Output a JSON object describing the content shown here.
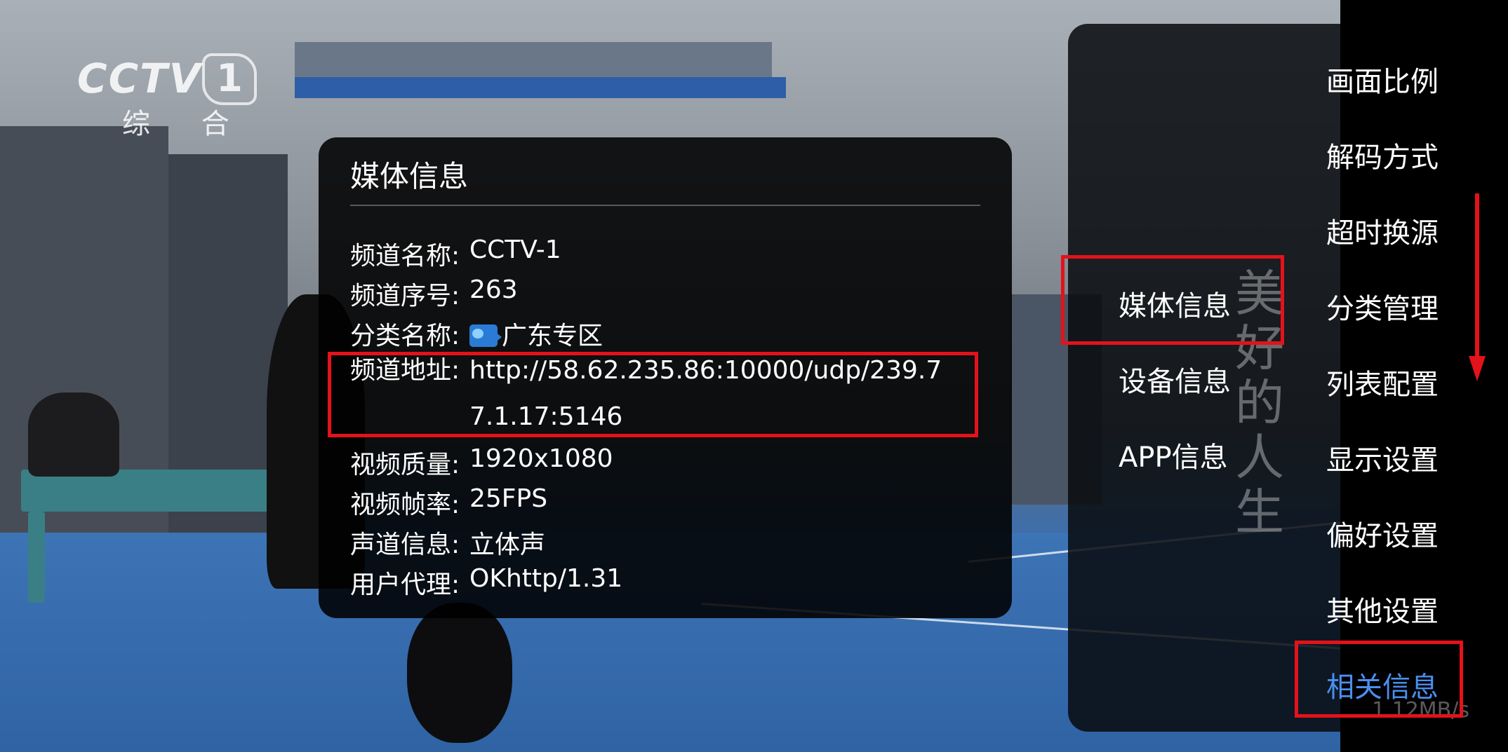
{
  "logo": {
    "brand": "CCTV",
    "channel_number": "1",
    "subtitle": "综 合"
  },
  "dialog": {
    "title": "媒体信息",
    "rows": [
      {
        "label": "频道名称:",
        "value": "CCTV-1"
      },
      {
        "label": "频道序号:",
        "value": "263"
      },
      {
        "label": "分类名称:",
        "value": "广东专区",
        "icon": "folder-video-icon"
      },
      {
        "label": "频道地址:",
        "value": "http://58.62.235.86:10000/udp/239.77.1.17:5146"
      },
      {
        "label": "视频质量:",
        "value": "1920x1080"
      },
      {
        "label": "视频帧率:",
        "value": "25FPS"
      },
      {
        "label": "声道信息:",
        "value": "立体声"
      },
      {
        "label": "用户代理:",
        "value": "OKhttp/1.31"
      }
    ]
  },
  "main_menu": {
    "items": [
      {
        "label": "画面比例",
        "active": false
      },
      {
        "label": "解码方式",
        "active": false
      },
      {
        "label": "超时换源",
        "active": false
      },
      {
        "label": "分类管理",
        "active": false
      },
      {
        "label": "列表配置",
        "active": false
      },
      {
        "label": "显示设置",
        "active": false
      },
      {
        "label": "偏好设置",
        "active": false
      },
      {
        "label": "其他设置",
        "active": false
      },
      {
        "label": "相关信息",
        "active": true
      }
    ],
    "scroll_indicator": "down-arrow-icon",
    "accent_color": "#4a8ff0"
  },
  "sub_menu": {
    "items": [
      {
        "label": "媒体信息",
        "focused": true
      },
      {
        "label": "设备信息",
        "focused": false
      },
      {
        "label": "APP信息",
        "focused": false
      }
    ]
  },
  "overlay": {
    "watermark": "美好的人生",
    "speed": "1.12MB/s"
  },
  "highlight_color": "#e4121a"
}
